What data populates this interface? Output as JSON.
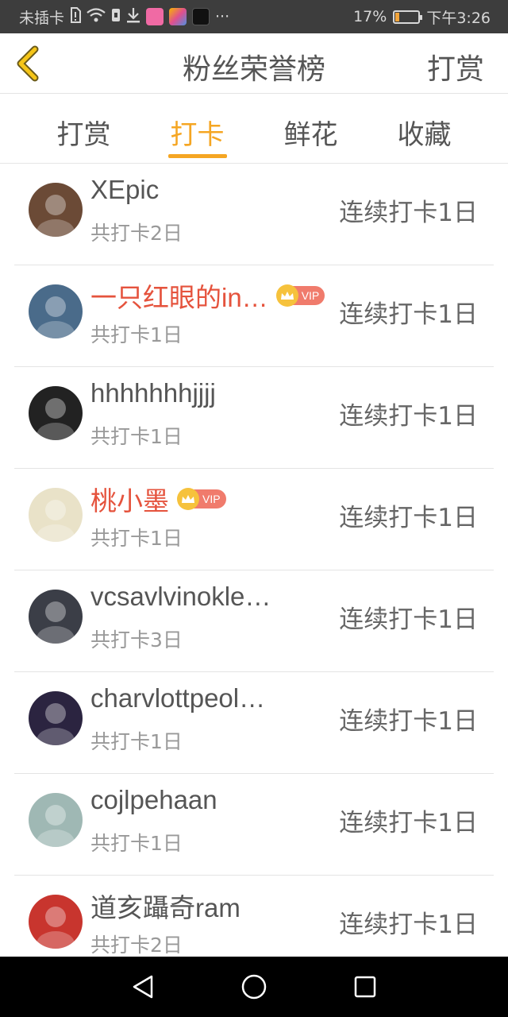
{
  "status_bar": {
    "carrier": "未插卡",
    "more": "···",
    "battery_percent": "17%",
    "battery_level": 0.17,
    "time": "下午3:26"
  },
  "header": {
    "title": "粉丝荣誉榜",
    "action": "打赏"
  },
  "tabs": [
    {
      "label": "打赏",
      "active": false
    },
    {
      "label": "打卡",
      "active": true
    },
    {
      "label": "鲜花",
      "active": false
    },
    {
      "label": "收藏",
      "active": false
    }
  ],
  "vip_label": "VIP",
  "rows": [
    {
      "name": "XEpic",
      "vip": false,
      "total": "共打卡2日",
      "streak": "连续打卡1日",
      "avatar_color": "#6b4a36"
    },
    {
      "name": "一只红眼的in…",
      "vip": true,
      "total": "共打卡1日",
      "streak": "连续打卡1日",
      "avatar_color": "#4a6b8a"
    },
    {
      "name": "hhhhhhhjjjj",
      "vip": false,
      "total": "共打卡1日",
      "streak": "连续打卡1日",
      "avatar_color": "#222222"
    },
    {
      "name": "桃小墨",
      "vip": true,
      "total": "共打卡1日",
      "streak": "连续打卡1日",
      "avatar_color": "#e9e2c8"
    },
    {
      "name": "vcsavlvinokle…",
      "vip": false,
      "total": "共打卡3日",
      "streak": "连续打卡1日",
      "avatar_color": "#3b3e47"
    },
    {
      "name": "charvlottpeol…",
      "vip": false,
      "total": "共打卡1日",
      "streak": "连续打卡1日",
      "avatar_color": "#2b2440"
    },
    {
      "name": "cojlpehaan",
      "vip": false,
      "total": "共打卡1日",
      "streak": "连续打卡1日",
      "avatar_color": "#9fb8b4"
    },
    {
      "name": "道亥躡奇ram",
      "vip": false,
      "total": "共打卡2日",
      "streak": "连续打卡1日",
      "avatar_color": "#c8352e"
    }
  ],
  "colors": {
    "accent": "#f5a623",
    "vip_name": "#e5533d",
    "text": "#555555",
    "subtext": "#999999"
  }
}
